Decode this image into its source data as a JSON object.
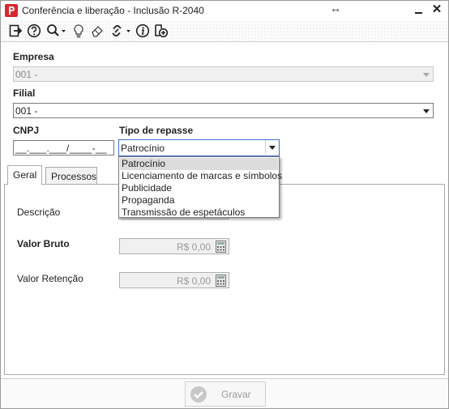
{
  "window": {
    "title": "Conferência e liberação - Inclusão R-2040",
    "minimize_icon": "minimize-icon",
    "close_label": "✕",
    "resize_icon": "↔"
  },
  "toolbar": {
    "icons": [
      "exit-icon",
      "help-icon",
      "search-icon",
      "lightbulb-icon",
      "eraser-icon",
      "link-icon",
      "info-icon",
      "add-icon"
    ]
  },
  "form": {
    "empresa_label": "Empresa",
    "empresa_value": "001 -",
    "filial_label": "Filial",
    "filial_value": "001 -",
    "cnpj_label": "CNPJ",
    "cnpj_value": "__.___.___/____-__",
    "tipo_repasse_label": "Tipo de repasse",
    "tipo_repasse_value": "Patrocínio"
  },
  "tipo_repasse_options": [
    "Patrocínio",
    "Licenciamento de marcas e símbolos",
    "Publicidade",
    "Propaganda",
    "Transmissão de espetáculos"
  ],
  "tabs": [
    {
      "label": "Geral",
      "active": true
    },
    {
      "label": "Processos",
      "active": false
    }
  ],
  "geral": {
    "descricao_label": "Descrição",
    "valor_bruto_label": "Valor Bruto",
    "valor_bruto_value": "R$ 0,00",
    "valor_retencao_label": "Valor Retenção",
    "valor_retencao_value": "R$ 0,00"
  },
  "footer": {
    "gravar_label": "Gravar"
  },
  "colors": {
    "brand": "#d9282f",
    "focus_border": "#3b6fd6",
    "selected_option": "#dcdcdc"
  }
}
